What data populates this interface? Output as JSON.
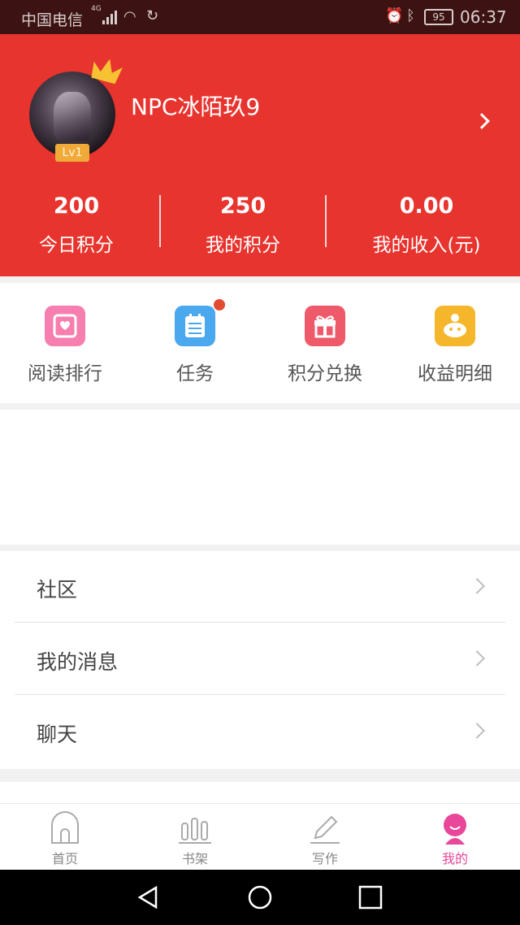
{
  "status_bar": {
    "carrier": "中国电信",
    "network": "4G",
    "battery": "95",
    "time": "06:37",
    "icons": [
      "signal-icon",
      "wifi-icon",
      "sync-icon",
      "alarm-icon",
      "bluetooth-icon",
      "battery-icon"
    ]
  },
  "profile": {
    "username": "NPC冰陌玖9",
    "level": "Lv1",
    "header_color": "#e8342e"
  },
  "stats": [
    {
      "value": "200",
      "label": "今日积分"
    },
    {
      "value": "250",
      "label": "我的积分"
    },
    {
      "value": "0.00",
      "label": "我的收入(元)"
    }
  ],
  "quick_actions": [
    {
      "label": "阅读排行",
      "icon": "reading-rank-icon",
      "color": "#f77fb0"
    },
    {
      "label": "任务",
      "icon": "task-icon",
      "color": "#4aa8ee",
      "has_dot": true
    },
    {
      "label": "积分兑换",
      "icon": "gift-icon",
      "color": "#ef5a6a"
    },
    {
      "label": "收益明细",
      "icon": "income-icon",
      "color": "#f5b62c"
    }
  ],
  "menu": [
    {
      "label": "社区"
    },
    {
      "label": "我的消息"
    },
    {
      "label": "聊天"
    }
  ],
  "tabs": [
    {
      "label": "首页",
      "icon": "home-icon"
    },
    {
      "label": "书架",
      "icon": "bookshelf-icon"
    },
    {
      "label": "写作",
      "icon": "pencil-icon"
    },
    {
      "label": "我的",
      "icon": "profile-icon",
      "active": true
    }
  ],
  "colors": {
    "accent": "#e8342e",
    "active_tab": "#e8479a"
  }
}
